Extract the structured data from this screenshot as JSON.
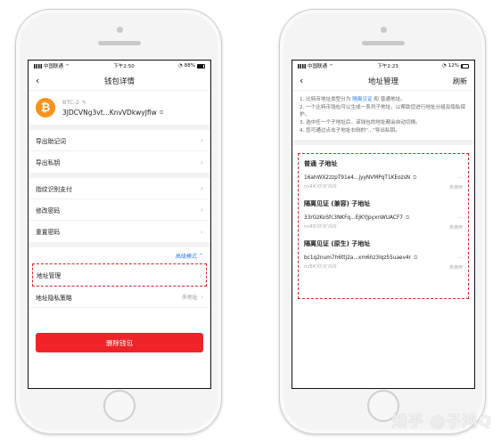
{
  "left_phone": {
    "status": {
      "carrier": "中国联通",
      "time": "下午2:50",
      "battery": "88%",
      "battery_level": 0.88
    },
    "nav": {
      "title": "钱包详情"
    },
    "wallet": {
      "name": "BTC-2",
      "address": "3JDCVNg3vt...KnvVDkwyJfiw",
      "logo": "₿"
    },
    "group1": [
      {
        "label": "导出助记词"
      },
      {
        "label": "导出私钥"
      }
    ],
    "group2": [
      {
        "label": "指纹识别支付"
      },
      {
        "label": "修改密码"
      },
      {
        "label": "重置密码"
      }
    ],
    "advanced_label": "高级模式",
    "address_manage": "地址管理",
    "privacy": {
      "label": "地址隐私策略",
      "value": "多地址"
    },
    "delete_label": "删除钱包"
  },
  "right_phone": {
    "status": {
      "carrier": "中国联通",
      "time": "下午2:23",
      "battery": "12%",
      "battery_level": 0.12
    },
    "nav": {
      "title": "地址管理",
      "right": "刷新"
    },
    "notes": {
      "line1_a": "1. 比特币地址类型分为",
      "line1_link": "隔离见证",
      "line1_b": "和 普通地址。",
      "line2": "2. 一个比特币钱包可以生成一系列子地址，以帮助您进行地址分组及隐私保护。",
      "line3": "3. 选中任一个子地址后，该钱包的地址都会自动切换。",
      "line4": "4. 您可通过点击子地址右侧的\"...\"导出私钥。"
    },
    "sections": [
      {
        "title": "普通 子地址",
        "address": "16ahWX2zzpT91e4...jyyNVMPqT1KEozsN",
        "path": "m/44'/0'/0'/0/0",
        "status": "未使用"
      },
      {
        "title": "隔离见证 (兼容) 子地址",
        "address": "33rGzKoSfc3NKFq...EJKYJpyxnWUACF7",
        "path": "m/49'/0'/0'/0/0",
        "status": "未使用"
      },
      {
        "title": "隔离见证 (原生) 子地址",
        "address": "bc1q2num7h6ttj2a...xm6hz3lqz55uaev4r",
        "path": "m/84'/0'/0'/0/0",
        "status": "未使用"
      }
    ]
  },
  "watermark": "知乎 @子鸿Q",
  "colors": {
    "accent_red": "#f0232b",
    "link_blue": "#2c7be5",
    "btc_orange": "#f7931a"
  }
}
